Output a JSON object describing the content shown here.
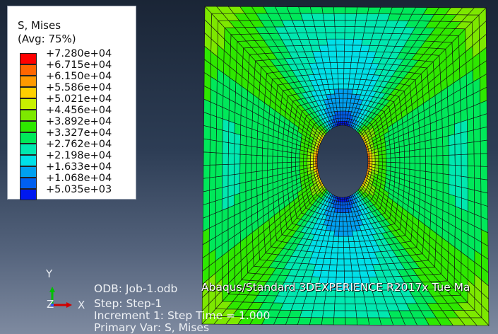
{
  "legend": {
    "title": "S, Mises",
    "subtitle": "(Avg: 75%)",
    "entries": [
      {
        "color": "#ff0000",
        "label": "+7.280e+04"
      },
      {
        "color": "#ff6600",
        "label": "+6.715e+04"
      },
      {
        "color": "#ff9a00",
        "label": "+6.150e+04"
      },
      {
        "color": "#ffd000",
        "label": "+5.586e+04"
      },
      {
        "color": "#c8f000",
        "label": "+5.021e+04"
      },
      {
        "color": "#7de800",
        "label": "+4.456e+04"
      },
      {
        "color": "#2ee800",
        "label": "+3.892e+04"
      },
      {
        "color": "#00e85a",
        "label": "+3.327e+04"
      },
      {
        "color": "#00e8b0",
        "label": "+2.762e+04"
      },
      {
        "color": "#00e0e8",
        "label": "+2.198e+04"
      },
      {
        "color": "#00a0f0",
        "label": "+1.633e+04"
      },
      {
        "color": "#0060f0",
        "label": "+1.068e+04"
      },
      {
        "color": "#0018f0",
        "label": "+5.035e+03"
      }
    ]
  },
  "triad": {
    "y": "Y",
    "z": "Z",
    "x": "X"
  },
  "info": {
    "odb": "ODB: Job-1.odb",
    "solver": "Abaqus/Standard 3DEXPERIENCE R2017x    Tue Ma",
    "step": "Step: Step-1",
    "increment": "Increment      1: Step Time =     1.000",
    "primary_var": "Primary Var: S, Mises"
  },
  "colors": {
    "background_top": "#1a2536",
    "background_bottom": "#7e8aa0",
    "mesh_edge": "#101010"
  }
}
